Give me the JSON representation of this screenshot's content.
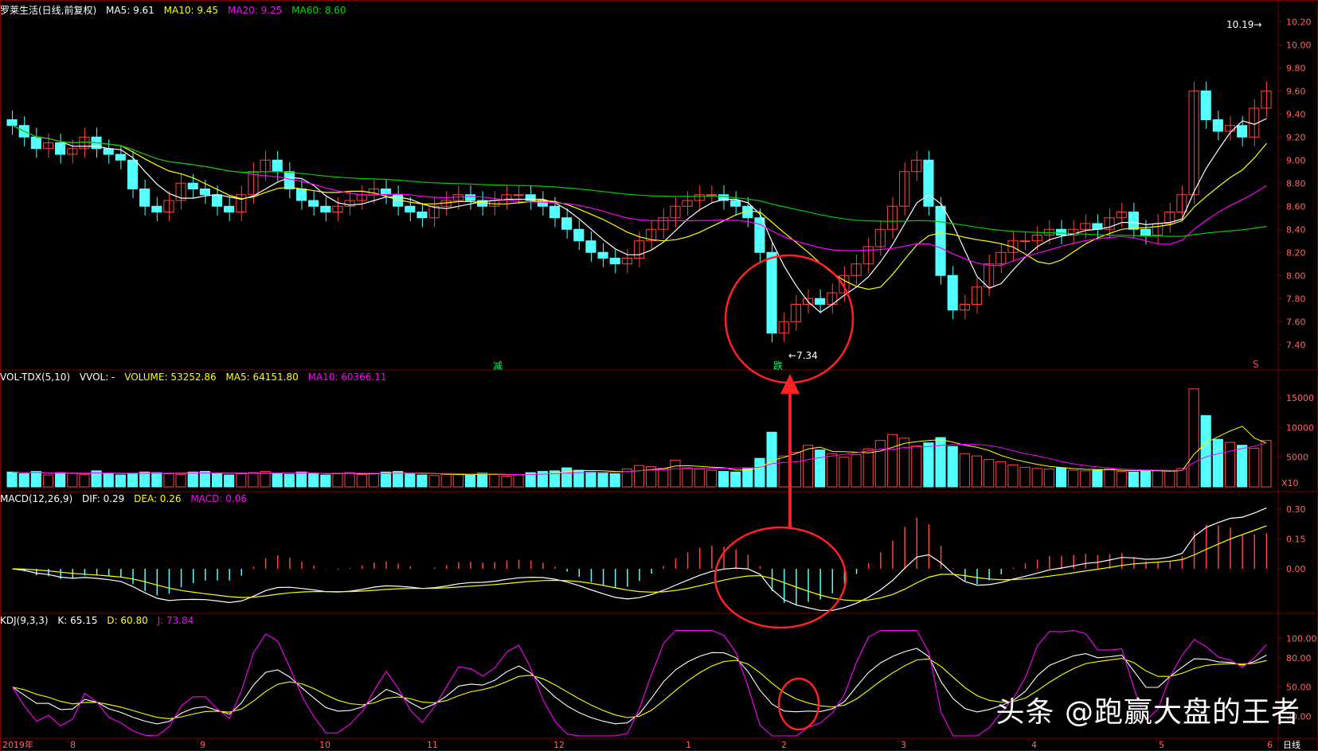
{
  "colors": {
    "up": "#ff4444",
    "down": "#54ffff",
    "ma5": "#ffffff",
    "ma10": "#ffff00",
    "ma20": "#ff00ff",
    "ma60": "#00cc00",
    "annot": "#ff2222",
    "grid": "#7a0000"
  },
  "main": {
    "stock": "罗莱生活(日线,前复权)",
    "ma5": "MA5: 9.61",
    "ma10": "MA10: 9.45",
    "ma20": "MA20: 9.25",
    "ma60": "MA60: 8.60",
    "high_label": "10.19",
    "low_label": "7.34",
    "tag_reduce": "减",
    "tag_fall": "跌",
    "tag_s": "S",
    "y_ticks": [
      "10.20",
      "10.00",
      "9.80",
      "9.60",
      "9.40",
      "9.20",
      "9.00",
      "8.80",
      "8.60",
      "8.40",
      "8.20",
      "8.00",
      "7.80",
      "7.60",
      "7.40"
    ]
  },
  "vol": {
    "name": "VOL-TDX(5,10)",
    "vvol": "VVOL: -",
    "volume": "VOLUME: 53252.86",
    "ma5": "MA5: 64151.80",
    "ma10": "MA10: 60366.11",
    "y_ticks": [
      "15000",
      "10000",
      "5000"
    ],
    "unit": "X10"
  },
  "macd": {
    "name": "MACD(12,26,9)",
    "dif": "DIF: 0.29",
    "dea": "DEA: 0.26",
    "macd": "MACD: 0.06",
    "y_ticks": [
      "0.30",
      "0.15",
      "0.00"
    ]
  },
  "kdj": {
    "name": "KDJ(9,3,3)",
    "k": "K: 65.15",
    "d": "D: 60.80",
    "j": "J: 73.84",
    "y_ticks": [
      "100.00",
      "80.00",
      "50.00",
      "20.00"
    ]
  },
  "x_axis": {
    "labels": [
      "2019年",
      "8",
      "9",
      "10",
      "11",
      "12",
      "1",
      "2",
      "3",
      "4",
      "5",
      "6"
    ],
    "period": "日线"
  },
  "watermark": "头条 @跑赢大盘的王者",
  "chart_data": [
    {
      "type": "candlestick",
      "title": "罗莱生活(日线,前复权)",
      "ylim": [
        7.25,
        10.25
      ],
      "series": [
        {
          "name": "Close",
          "values": [
            9.3,
            9.2,
            9.1,
            9.15,
            9.05,
            9.1,
            9.2,
            9.1,
            9.05,
            9.0,
            8.75,
            8.6,
            8.55,
            8.65,
            8.8,
            8.75,
            8.7,
            8.6,
            8.55,
            8.7,
            8.9,
            9.0,
            8.9,
            8.75,
            8.65,
            8.6,
            8.55,
            8.6,
            8.65,
            8.7,
            8.75,
            8.7,
            8.6,
            8.55,
            8.5,
            8.6,
            8.65,
            8.7,
            8.65,
            8.6,
            8.65,
            8.7,
            8.7,
            8.65,
            8.6,
            8.5,
            8.4,
            8.3,
            8.2,
            8.15,
            8.1,
            8.15,
            8.3,
            8.4,
            8.5,
            8.6,
            8.65,
            8.7,
            8.7,
            8.65,
            8.6,
            8.5,
            8.2,
            7.5,
            7.6,
            7.75,
            7.8,
            7.75,
            7.85,
            8.0,
            8.1,
            8.25,
            8.4,
            8.6,
            8.9,
            9.0,
            8.6,
            8.0,
            7.7,
            7.75,
            7.9,
            8.1,
            8.2,
            8.3,
            8.3,
            8.35,
            8.4,
            8.35,
            8.4,
            8.45,
            8.4,
            8.5,
            8.55,
            8.4,
            8.35,
            8.45,
            8.55,
            8.7,
            9.6,
            9.35,
            9.25,
            9.3,
            9.2,
            9.45,
            9.6
          ]
        },
        {
          "name": "MA5",
          "values": [
            9.61
          ]
        },
        {
          "name": "MA10",
          "values": [
            9.45
          ]
        },
        {
          "name": "MA20",
          "values": [
            9.25
          ]
        },
        {
          "name": "MA60",
          "values": [
            8.6
          ]
        }
      ]
    },
    {
      "type": "bar",
      "title": "VOL-TDX(5,10)",
      "ylim": [
        0,
        17000
      ],
      "series": [
        {
          "name": "VOLUME",
          "values": [
            2500,
            2200,
            2600,
            2000,
            2400,
            2300,
            2100,
            2700,
            2200,
            2000,
            2300,
            2500,
            2400,
            2200,
            2100,
            2500,
            2600,
            2300,
            2000,
            2200,
            2400,
            2600,
            2300,
            2100,
            2500,
            2200,
            2000,
            2300,
            2400,
            2100,
            2200,
            2500,
            2600,
            2200,
            2000,
            1900,
            2100,
            2200,
            2000,
            2300,
            2100,
            1800,
            2000,
            2400,
            2600,
            2700,
            3200,
            2800,
            2500,
            2300,
            2200,
            3000,
            3600,
            3400,
            3100,
            4500,
            3200,
            3000,
            2800,
            2600,
            2500,
            3200,
            4800,
            9200,
            5200,
            5800,
            7000,
            6200,
            5600,
            5000,
            5400,
            6400,
            7800,
            8800,
            8200,
            6900,
            7400,
            8300,
            6800,
            5600,
            5200,
            4600,
            4200,
            3700,
            3300,
            3100,
            3000,
            3200,
            2800,
            2700,
            2900,
            3000,
            2600,
            2500,
            2600,
            2800,
            2700,
            3100,
            16500,
            12000,
            8000,
            7500,
            7000,
            6500,
            7800
          ]
        }
      ]
    },
    {
      "type": "line",
      "title": "MACD(12,26,9)",
      "ylim": [
        -0.2,
        0.32
      ],
      "series": [
        {
          "name": "DIF",
          "values": [
            0.29
          ]
        },
        {
          "name": "DEA",
          "values": [
            0.26
          ]
        },
        {
          "name": "MACD",
          "values": [
            0.06
          ]
        }
      ]
    },
    {
      "type": "line",
      "title": "KDJ(9,3,3)",
      "ylim": [
        0,
        110
      ],
      "series": [
        {
          "name": "K",
          "values": [
            65.15
          ]
        },
        {
          "name": "D",
          "values": [
            60.8
          ]
        },
        {
          "name": "J",
          "values": [
            73.84
          ]
        }
      ]
    }
  ]
}
